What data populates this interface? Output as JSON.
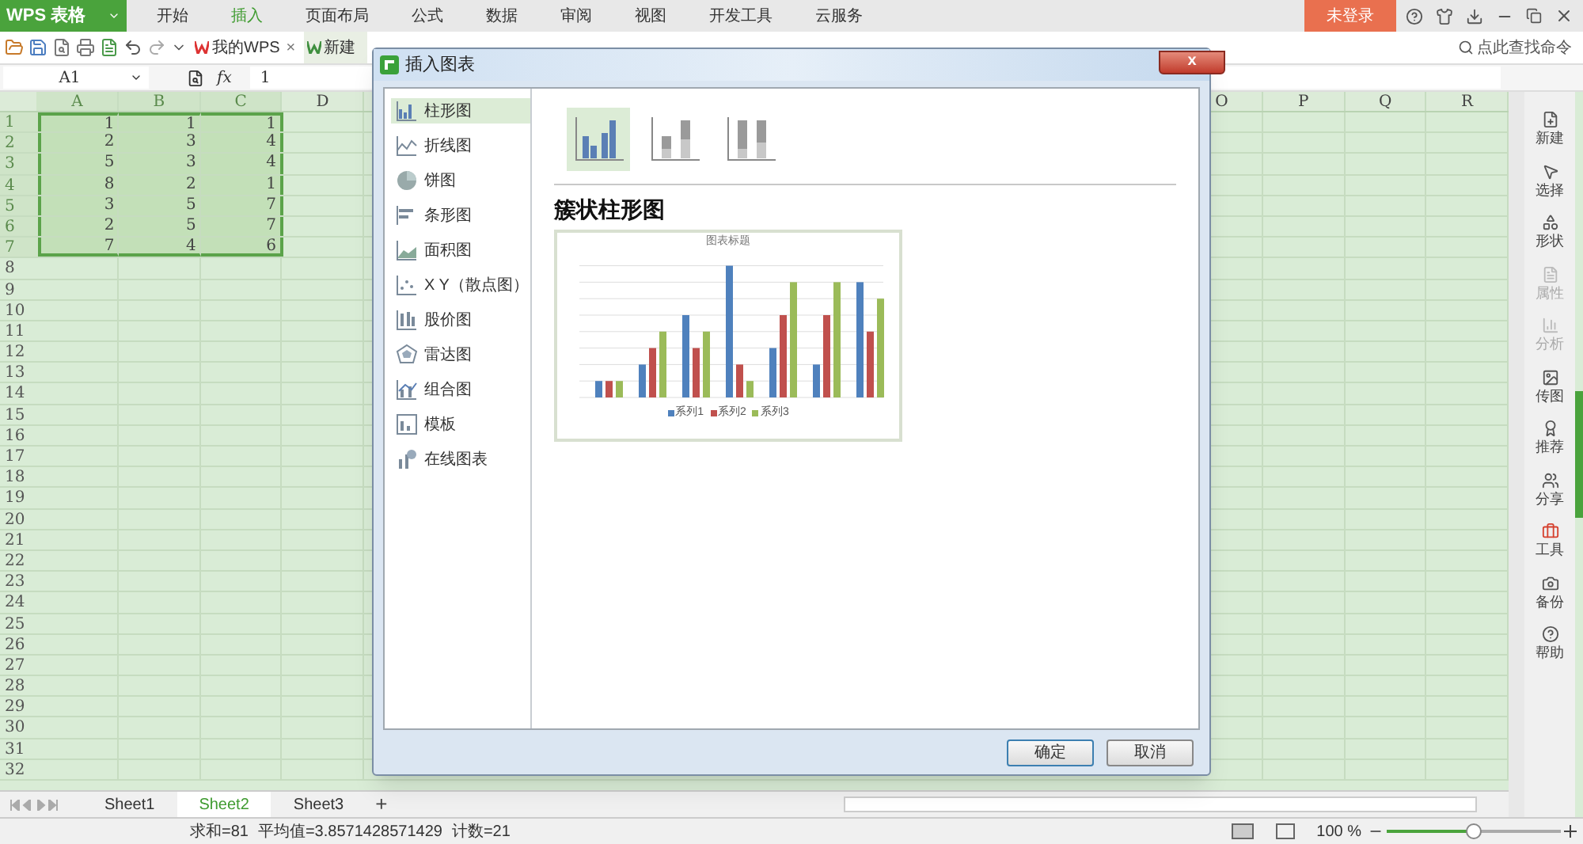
{
  "app": {
    "name": "WPS 表格",
    "login": "未登录"
  },
  "menu_tabs": [
    {
      "label": "开始",
      "selected": false
    },
    {
      "label": "插入",
      "selected": true
    },
    {
      "label": "页面布局",
      "selected": false
    },
    {
      "label": "公式",
      "selected": false
    },
    {
      "label": "数据",
      "selected": false
    },
    {
      "label": "审阅",
      "selected": false
    },
    {
      "label": "视图",
      "selected": false
    },
    {
      "label": "开发工具",
      "selected": false
    },
    {
      "label": "云服务",
      "selected": false
    }
  ],
  "doc_tabs": [
    {
      "label": "我的WPS",
      "close": "×",
      "selected": false
    },
    {
      "label": "新建",
      "selected": true
    }
  ],
  "command_search": {
    "placeholder": "点此查找命令"
  },
  "formula_bar": {
    "cell": "A1",
    "fx": "fx",
    "value": "1"
  },
  "columns": [
    "A",
    "B",
    "C",
    "D",
    "O",
    "P",
    "Q",
    "R"
  ],
  "rows": [
    {
      "label": "1",
      "cells": [
        "1",
        "1",
        "1"
      ]
    },
    {
      "label": "2",
      "cells": [
        "2",
        "3",
        "4"
      ]
    },
    {
      "label": "3",
      "cells": [
        "5",
        "3",
        "4"
      ]
    },
    {
      "label": "4",
      "cells": [
        "8",
        "2",
        "1"
      ]
    },
    {
      "label": "5",
      "cells": [
        "3",
        "5",
        "7"
      ]
    },
    {
      "label": "6",
      "cells": [
        "2",
        "5",
        "7"
      ]
    },
    {
      "label": "7",
      "cells": [
        "7",
        "4",
        "6"
      ]
    },
    {
      "label": "8"
    },
    {
      "label": "9"
    },
    {
      "label": "10"
    },
    {
      "label": "11"
    },
    {
      "label": "12"
    },
    {
      "label": "13"
    },
    {
      "label": "14"
    },
    {
      "label": "15"
    },
    {
      "label": "16"
    },
    {
      "label": "17"
    },
    {
      "label": "18"
    },
    {
      "label": "19"
    },
    {
      "label": "20"
    },
    {
      "label": "21"
    },
    {
      "label": "22"
    },
    {
      "label": "23"
    },
    {
      "label": "24"
    },
    {
      "label": "25"
    },
    {
      "label": "26"
    },
    {
      "label": "27"
    },
    {
      "label": "28"
    },
    {
      "label": "29"
    },
    {
      "label": "30"
    },
    {
      "label": "31"
    },
    {
      "label": "32"
    }
  ],
  "side_panel": [
    {
      "label": "新建",
      "disabled": false
    },
    {
      "label": "选择",
      "disabled": false
    },
    {
      "label": "形状",
      "disabled": false
    },
    {
      "label": "属性",
      "disabled": true
    },
    {
      "label": "分析",
      "disabled": true
    },
    {
      "label": "传图",
      "disabled": false
    },
    {
      "label": "推荐",
      "disabled": false
    },
    {
      "label": "分享",
      "disabled": false
    },
    {
      "label": "工具",
      "disabled": false
    },
    {
      "label": "备份",
      "disabled": false
    },
    {
      "label": "帮助",
      "disabled": false
    }
  ],
  "sheet_tabs": [
    {
      "label": "Sheet1",
      "selected": false
    },
    {
      "label": "Sheet2",
      "selected": true
    },
    {
      "label": "Sheet3",
      "selected": false
    }
  ],
  "add_sheet": "+",
  "status_bar": {
    "sum": "求和=81",
    "average": "平均值=3.8571428571429",
    "count": "计数=21",
    "zoom": "100 %",
    "zoom_level": {
      "level": 0.5
    }
  },
  "dialog": {
    "title": "插入图表",
    "close": "x",
    "chart_types": [
      {
        "label": "柱形图",
        "selected": true
      },
      {
        "label": "折线图",
        "selected": false
      },
      {
        "label": "饼图",
        "selected": false
      },
      {
        "label": "条形图",
        "selected": false
      },
      {
        "label": "面积图",
        "selected": false
      },
      {
        "label": "X Y（散点图）",
        "selected": false
      },
      {
        "label": "股价图",
        "selected": false
      },
      {
        "label": "雷达图",
        "selected": false
      },
      {
        "label": "组合图",
        "selected": false
      },
      {
        "label": "模板",
        "selected": false
      },
      {
        "label": "在线图表",
        "selected": false
      }
    ],
    "subtypes": [
      {
        "selected": true
      },
      {
        "selected": false
      },
      {
        "selected": false
      }
    ],
    "subtype_name": "簇状柱形图",
    "preview": {
      "title": "图表标题",
      "legend": [
        "系列1",
        "系列2",
        "系列3"
      ]
    },
    "buttons": [
      "确定",
      "取消"
    ]
  }
}
